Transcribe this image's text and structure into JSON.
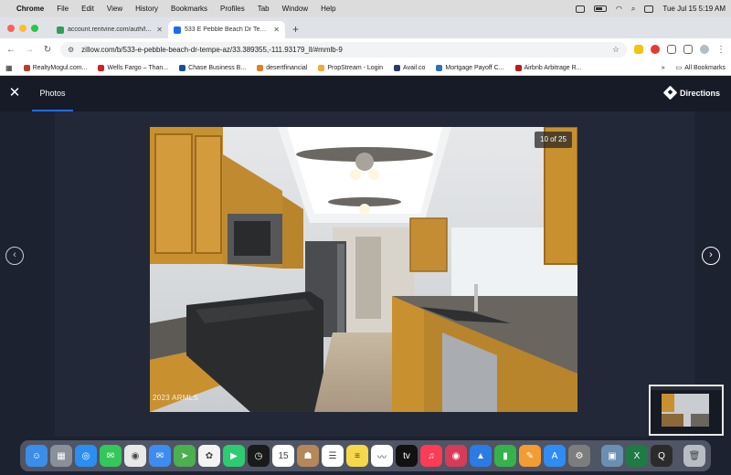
{
  "menubar": {
    "app": "Chrome",
    "items": [
      "File",
      "Edit",
      "View",
      "History",
      "Bookmarks",
      "Profiles",
      "Tab",
      "Window",
      "Help"
    ],
    "datetime": "Tue Jul 15  5:19 AM"
  },
  "tabs": [
    {
      "label": "account.rentvine.com/auth/l...",
      "active": false,
      "favicon_color": "#2e9e58"
    },
    {
      "label": "533 E Pebble Beach Dr Tempe...",
      "active": true,
      "favicon_color": "#1a6eea"
    }
  ],
  "addressbar": {
    "url": "zillow.com/b/533-e-pebble-beach-dr-tempe-az/33.389355,-111.93179_ll/#mmlb-9"
  },
  "bookmarks": {
    "items": [
      {
        "label": "RealtyMogul.com...",
        "color": "#c0392b"
      },
      {
        "label": "Wells Fargo – Than...",
        "color": "#d71e28"
      },
      {
        "label": "Chase Business B...",
        "color": "#1a4c9c"
      },
      {
        "label": "desertfinancial",
        "color": "#e67e22"
      },
      {
        "label": "PropStream - Login",
        "color": "#f4a93b"
      },
      {
        "label": "Avail.co",
        "color": "#2b3a67"
      },
      {
        "label": "Mortgage Payoff C...",
        "color": "#2f6fbd"
      },
      {
        "label": "Airbnb Arbitrage R...",
        "color": "#b71c1c"
      }
    ],
    "more": "»",
    "all_label": "All Bookmarks"
  },
  "lightbox": {
    "close": "✕",
    "tab_label": "Photos",
    "directions_label": "Directions",
    "counter": "10 of 25",
    "watermark": "2023 ARMLS",
    "prev_arrow": "‹",
    "next_arrow": "›",
    "photo_subject": "kitchen"
  },
  "dock": {
    "apps": [
      {
        "name": "finder-icon",
        "color": "#3b8ee8",
        "glyph": "☺"
      },
      {
        "name": "launchpad-icon",
        "color": "#8a8f9a",
        "glyph": "▦"
      },
      {
        "name": "safari-icon",
        "color": "#2d8ef2",
        "glyph": "◎"
      },
      {
        "name": "messages-icon",
        "color": "#35c759",
        "glyph": "✉"
      },
      {
        "name": "chrome-icon",
        "color": "#e8e8e8",
        "glyph": "◉"
      },
      {
        "name": "mail-icon",
        "color": "#3f8cf0",
        "glyph": "✉"
      },
      {
        "name": "maps-icon",
        "color": "#4caf50",
        "glyph": "➤"
      },
      {
        "name": "photos-icon",
        "color": "#f3f3f3",
        "glyph": "✿"
      },
      {
        "name": "facetime-icon",
        "color": "#2ecc71",
        "glyph": "▶"
      },
      {
        "name": "clock-icon",
        "color": "#1a1a1a",
        "glyph": "◷"
      },
      {
        "name": "calendar-icon",
        "color": "#ffffff",
        "glyph": "15"
      },
      {
        "name": "contacts-icon",
        "color": "#b5875a",
        "glyph": "☗"
      },
      {
        "name": "reminders-icon",
        "color": "#ffffff",
        "glyph": "☰"
      },
      {
        "name": "notes-icon",
        "color": "#f7d84b",
        "glyph": "≡"
      },
      {
        "name": "freeform-icon",
        "color": "#ffffff",
        "glyph": "〰"
      },
      {
        "name": "tv-icon",
        "color": "#111111",
        "glyph": "tv"
      },
      {
        "name": "music-icon",
        "color": "#fa3c55",
        "glyph": "♫"
      },
      {
        "name": "podcasts-icon",
        "color": "#d63b5a",
        "glyph": "◉"
      },
      {
        "name": "keynote-icon",
        "color": "#2c7be5",
        "glyph": "▲"
      },
      {
        "name": "numbers-icon",
        "color": "#35b34a",
        "glyph": "▮"
      },
      {
        "name": "pages-icon",
        "color": "#f39c32",
        "glyph": "✎"
      },
      {
        "name": "appstore-icon",
        "color": "#2f8cf5",
        "glyph": "A"
      },
      {
        "name": "settings-icon",
        "color": "#7d7d7d",
        "glyph": "⚙"
      },
      {
        "name": "preview-icon",
        "color": "#6b8fb0",
        "glyph": "▣"
      },
      {
        "name": "excel-icon",
        "color": "#1f7a43",
        "glyph": "X"
      },
      {
        "name": "quicktime-icon",
        "color": "#2b2b2b",
        "glyph": "Q"
      },
      {
        "name": "trash-icon",
        "color": "#b8bcc4",
        "glyph": "🗑"
      }
    ]
  }
}
